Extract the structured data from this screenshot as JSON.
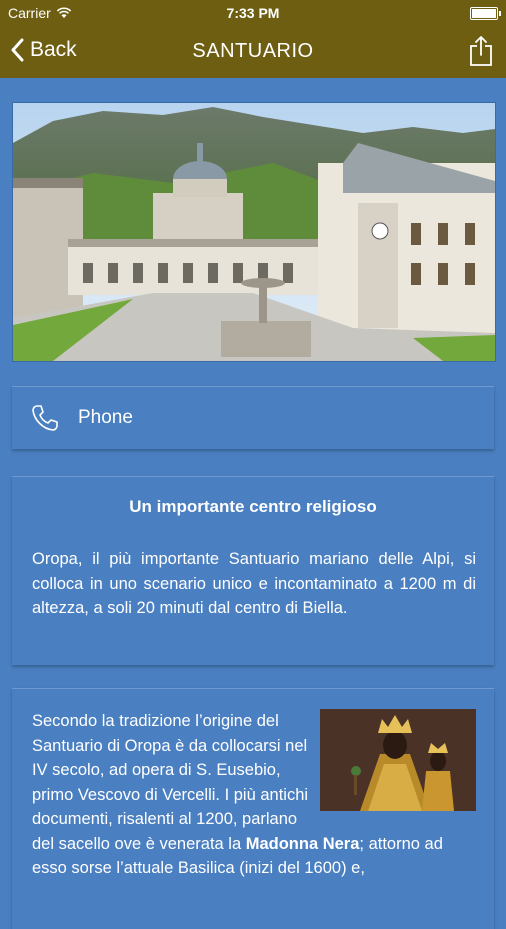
{
  "status_bar": {
    "carrier": "Carrier",
    "time": "7:33 PM"
  },
  "nav": {
    "back_label": "Back",
    "title": "SANTUARIO"
  },
  "phone": {
    "label": "Phone"
  },
  "intro": {
    "title": "Un importante centro religioso",
    "text": "Oropa, il più importante Santuario mariano delle Alpi, si colloca in uno scenario unico e incontaminato a 1200 m di altezza, a soli 20 minuti dal centro di Biella."
  },
  "history": {
    "text_before": "Secondo la tradizione l’origine del Santuario di Oropa è da collocarsi nel IV secolo, ad opera di S. Eusebio, primo Vescovo di Vercelli. I più antichi documenti, risalenti al 1200, parlano del sacello ove è venerata la ",
    "text_bold": "Madonna Nera",
    "text_after": "; attorno ad esso sorse l’attuale Basilica (inizi del 1600) e,"
  },
  "colors": {
    "bar": "#6e5e12",
    "background": "#4a7fc1",
    "text": "#ffffff"
  },
  "icons": [
    "wifi-icon",
    "battery-icon",
    "back-chevron-icon",
    "share-icon",
    "phone-icon"
  ]
}
